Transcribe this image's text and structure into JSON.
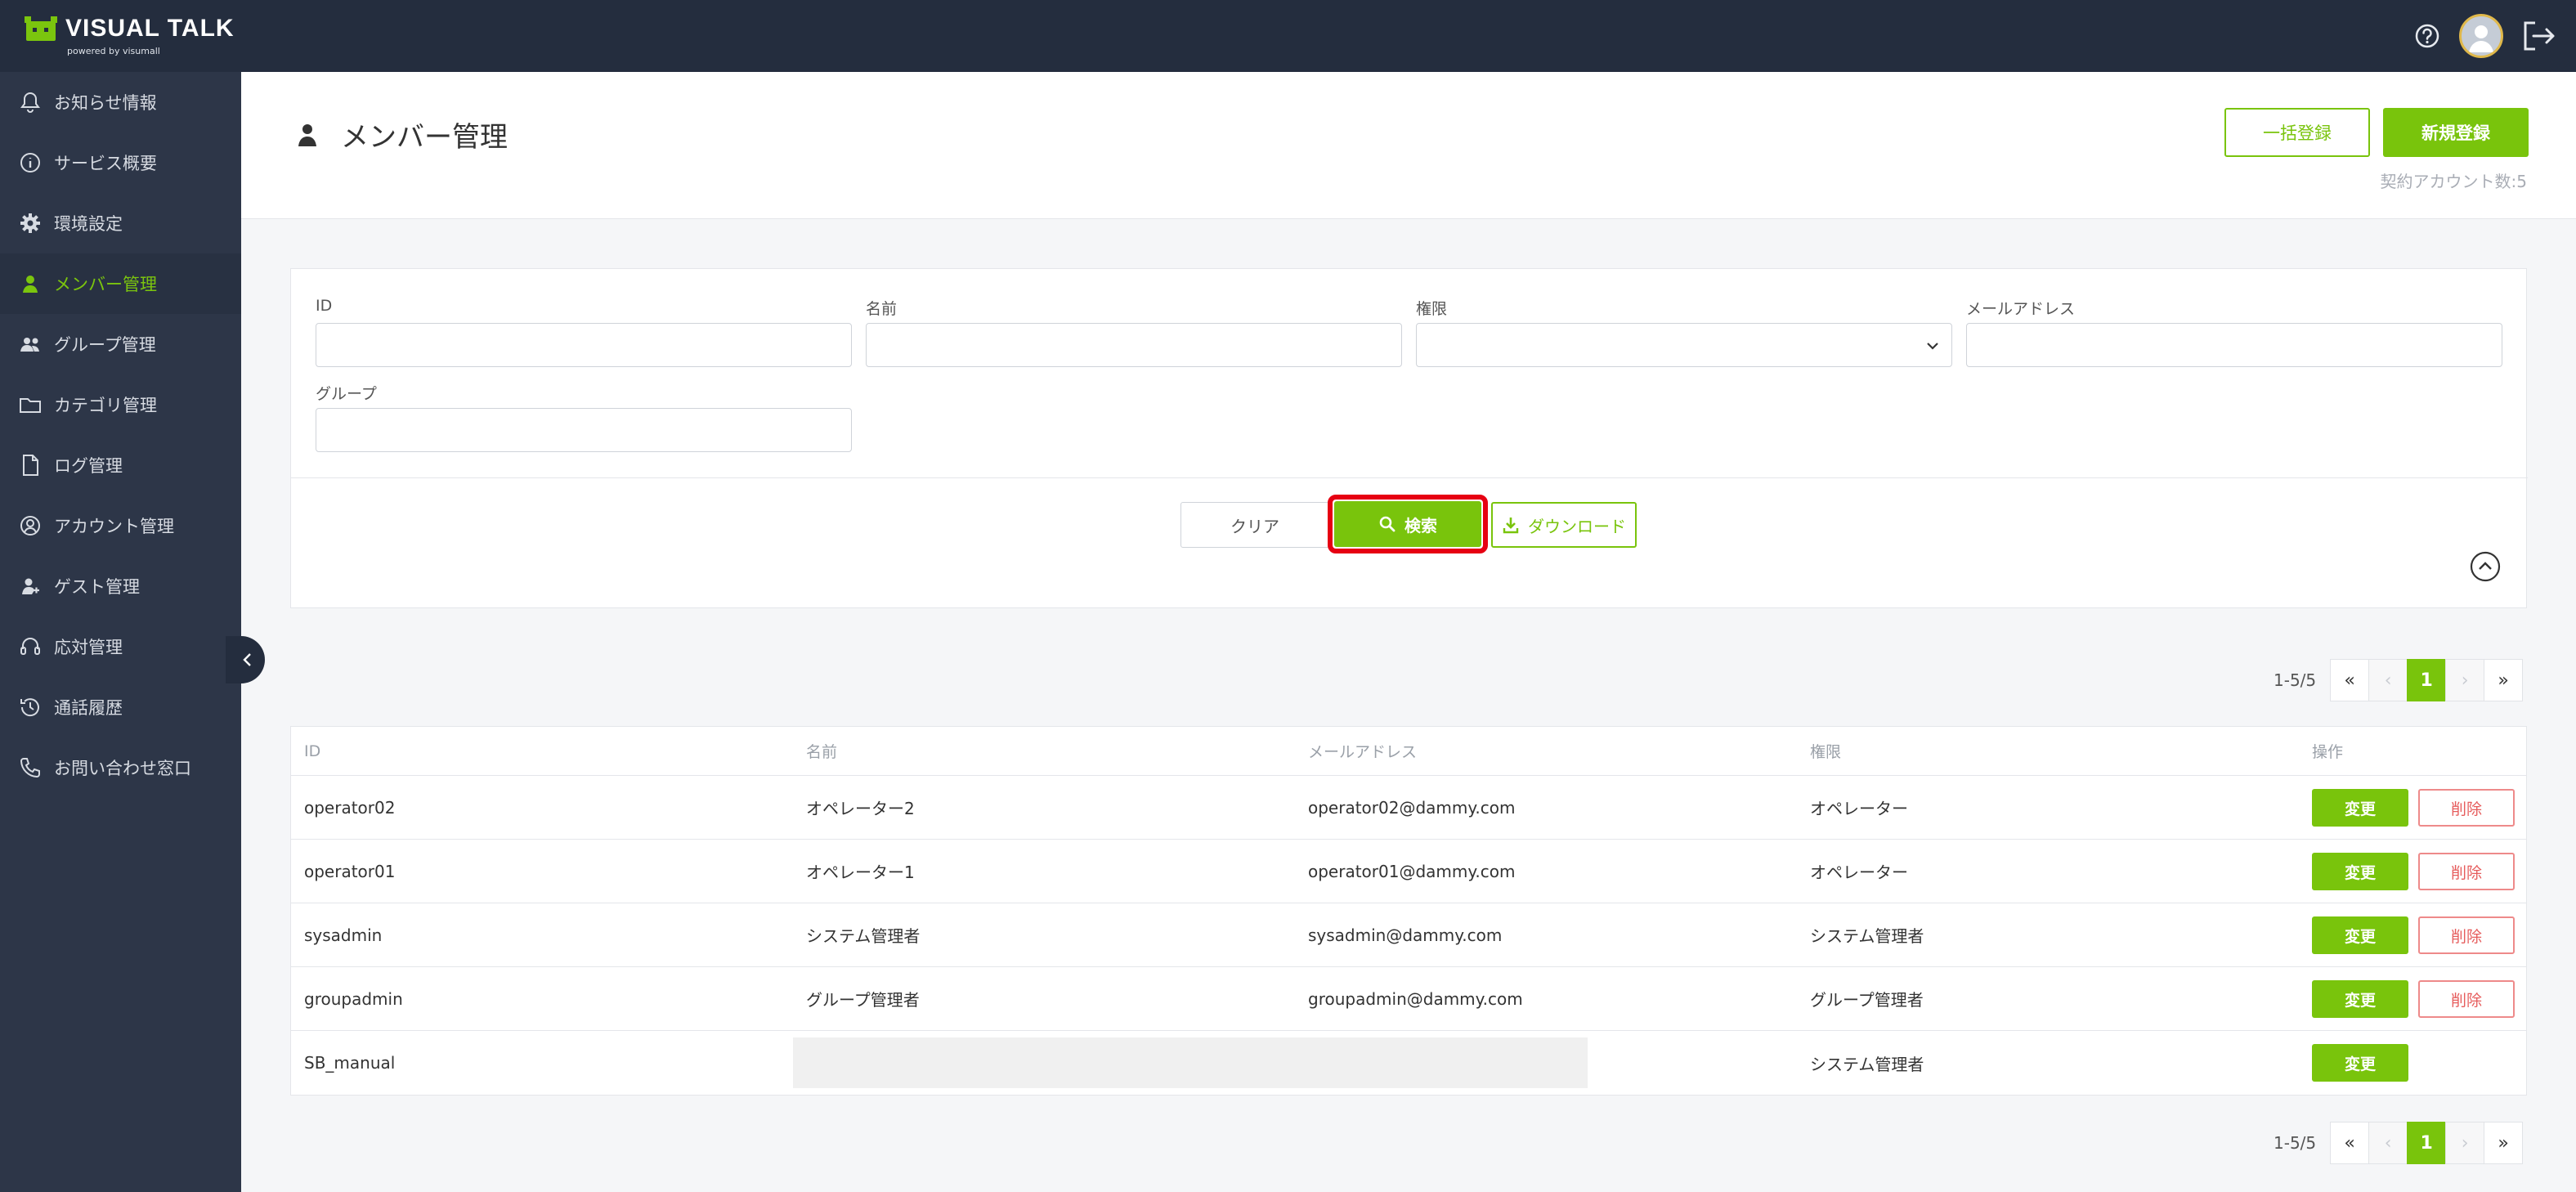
{
  "app": {
    "logo_text": "VISUAL TALK",
    "logo_sub": "powered by visumall"
  },
  "sidebar": {
    "items": [
      {
        "label": "お知らせ情報",
        "icon": "bell-icon"
      },
      {
        "label": "サービス概要",
        "icon": "info-icon"
      },
      {
        "label": "環境設定",
        "icon": "gear-icon"
      },
      {
        "label": "メンバー管理",
        "icon": "person-icon",
        "active": true
      },
      {
        "label": "グループ管理",
        "icon": "group-icon"
      },
      {
        "label": "カテゴリ管理",
        "icon": "folder-icon"
      },
      {
        "label": "ログ管理",
        "icon": "file-icon"
      },
      {
        "label": "アカウント管理",
        "icon": "user-circle-icon"
      },
      {
        "label": "ゲスト管理",
        "icon": "guest-icon"
      },
      {
        "label": "応対管理",
        "icon": "headset-icon"
      },
      {
        "label": "通話履歴",
        "icon": "history-icon"
      },
      {
        "label": "お問い合わせ窓口",
        "icon": "phone-icon"
      }
    ]
  },
  "header": {
    "title": "メンバー管理",
    "bulk_label": "一括登録",
    "new_label": "新規登録",
    "contract_count": "契約アカウント数:5"
  },
  "search": {
    "id_label": "ID",
    "name_label": "名前",
    "role_label": "権限",
    "email_label": "メールアドレス",
    "group_label": "グループ",
    "clear_label": "クリア",
    "search_label": "検索",
    "download_label": "ダウンロード"
  },
  "pagination": {
    "range": "1-5/5",
    "first": "«",
    "prev": "‹",
    "current": "1",
    "next": "›",
    "last": "»"
  },
  "table": {
    "headers": {
      "id": "ID",
      "name": "名前",
      "email": "メールアドレス",
      "role": "権限",
      "ops": "操作"
    },
    "edit_label": "変更",
    "delete_label": "削除",
    "rows": [
      {
        "id": "operator02",
        "name": "オペレーター2",
        "email": "operator02@dammy.com",
        "role": "オペレーター"
      },
      {
        "id": "operator01",
        "name": "オペレーター1",
        "email": "operator01@dammy.com",
        "role": "オペレーター"
      },
      {
        "id": "sysadmin",
        "name": "システム管理者",
        "email": "sysadmin@dammy.com",
        "role": "システム管理者"
      },
      {
        "id": "groupadmin",
        "name": "グループ管理者",
        "email": "groupadmin@dammy.com",
        "role": "グループ管理者"
      },
      {
        "id": "SB_manual",
        "name": "",
        "email": "",
        "role": "システム管理者"
      }
    ]
  },
  "colors": {
    "accent": "#79c40c",
    "topbar": "#242d3e",
    "sidebar": "#2d3648",
    "highlight": "#e60012"
  }
}
